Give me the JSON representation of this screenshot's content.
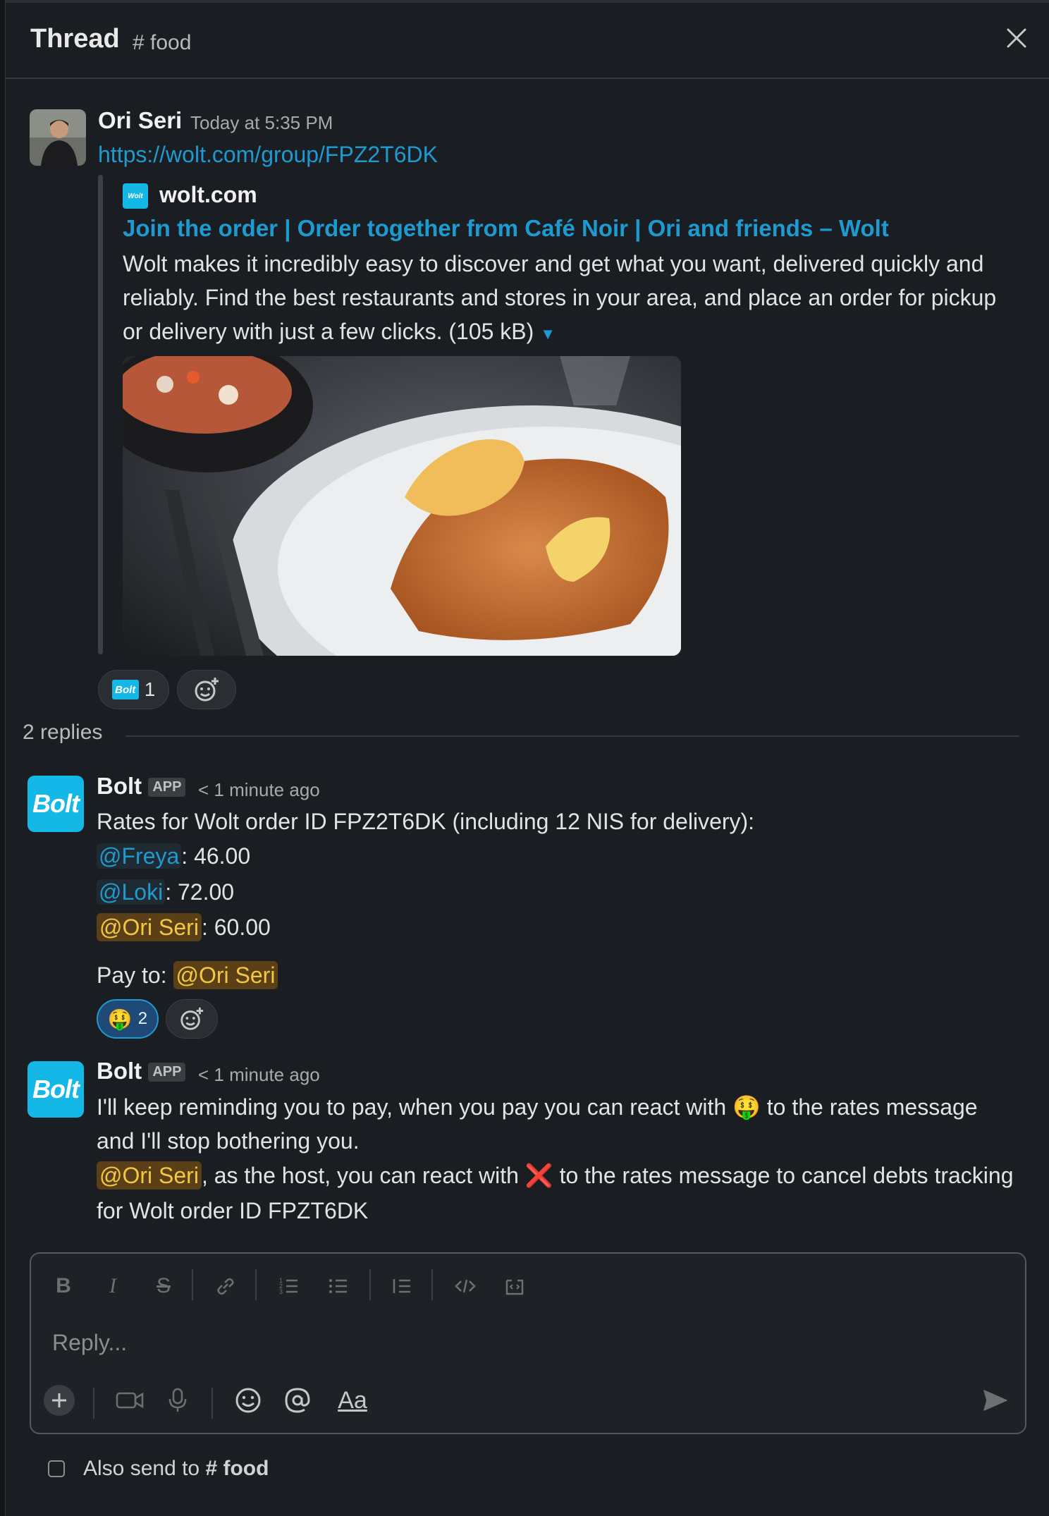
{
  "header": {
    "title": "Thread",
    "channel": "# food"
  },
  "parent": {
    "author": "Ori Seri",
    "time": "Today at 5:35 PM",
    "link": "https://wolt.com/group/FPZ2T6DK",
    "unfurl": {
      "logo_text": "Wolt",
      "site": "wolt.com",
      "title": "Join the order | Order together from Café Noir | Ori and friends – Wolt",
      "desc": "Wolt makes it incredibly easy to discover and get what you want, delivered quickly and reliably. Find the best restaurants and stores in your area, and place an order for pickup or delivery with just a few clicks. (105 kB)"
    },
    "reaction": {
      "emoji_label": "Bolt",
      "count": "1"
    }
  },
  "replies_label": "2 replies",
  "reply1": {
    "author": "Bolt",
    "badge": "APP",
    "time": "< 1 minute ago",
    "line1": "Rates for Wolt order ID FPZ2T6DK (including 12 NIS for delivery):",
    "rows": [
      {
        "mention": "@Freya",
        "amount": ": 46.00"
      },
      {
        "mention": "@Loki",
        "amount": ": 72.00"
      },
      {
        "mention": "@Ori Seri",
        "amount": ": 60.00"
      }
    ],
    "pay_to_label": "Pay to: ",
    "pay_to_mention": "@Ori Seri",
    "reaction": {
      "emoji": "🤑",
      "count": "2"
    }
  },
  "reply2": {
    "author": "Bolt",
    "badge": "APP",
    "time": "< 1 minute ago",
    "l1a": "I'll keep reminding you to pay, when you pay you can react with ",
    "l1emoji": "🤑",
    "l1b": " to the rates message",
    "l2": "and I'll stop bothering you.",
    "l3mention": "@Ori Seri",
    "l3a": ", as the host, you can react with ",
    "l3emoji": "❌",
    "l3b": " to the rates message to cancel debts tracking",
    "l4": "for Wolt order ID FPZT6DK"
  },
  "composer": {
    "placeholder": "Reply...",
    "format_label": "Aa"
  },
  "also_send": {
    "label": "Also send to ",
    "channel": "# food"
  },
  "bolt_logo_text": "Bolt"
}
